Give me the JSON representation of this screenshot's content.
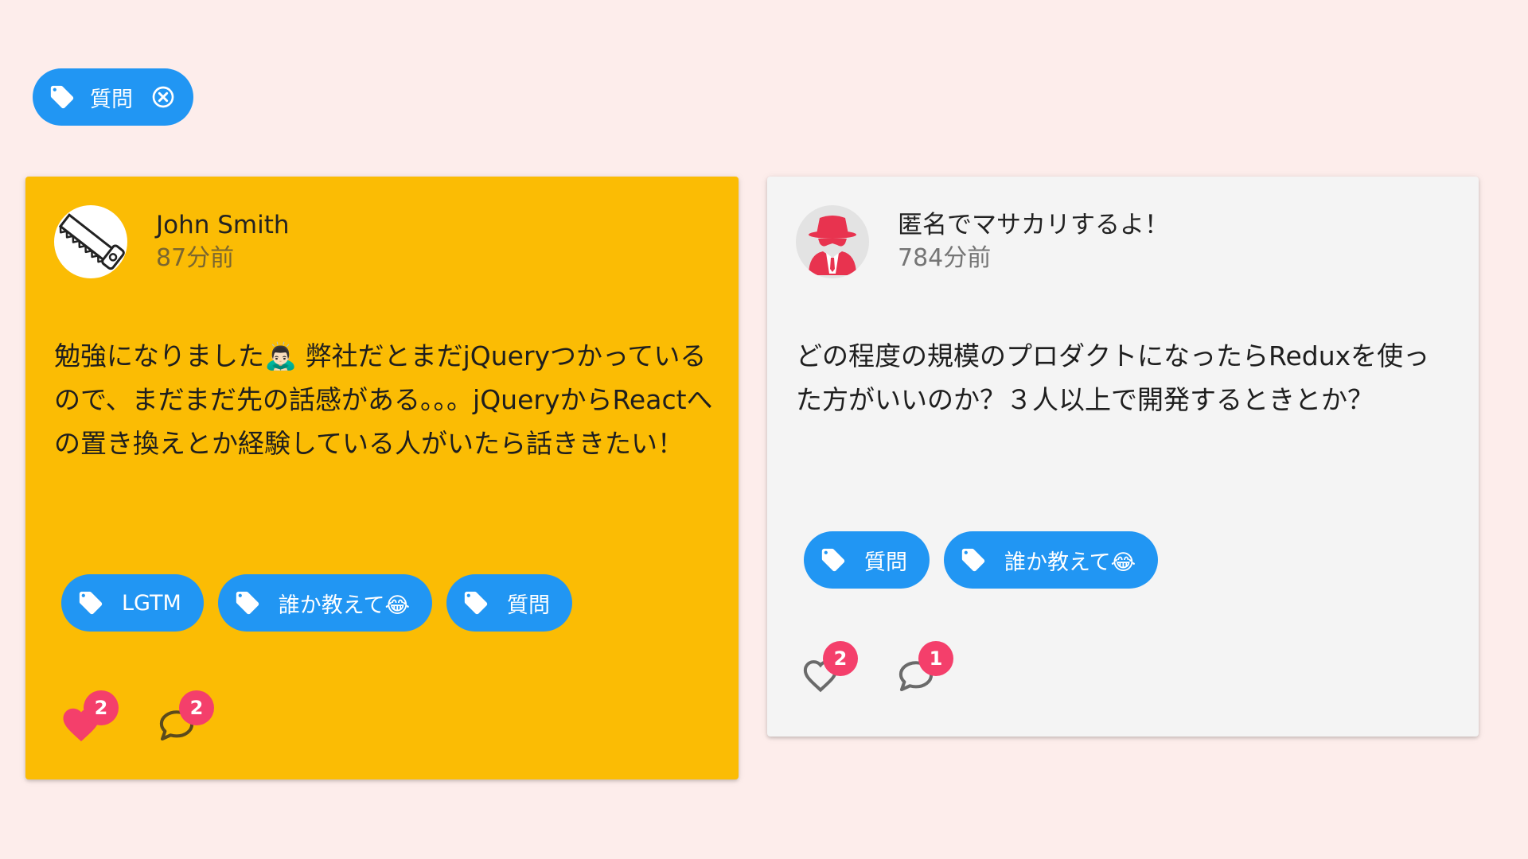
{
  "filter": {
    "label": "質問",
    "icon": "tag-icon",
    "clear_icon": "close-circle-icon"
  },
  "posts": [
    {
      "author": "John Smith",
      "time": "87分前",
      "avatar_icon": "saw-avatar-icon",
      "body": "勉強になりました🙇🏻‍♂️ 弊社だとまだjQueryつかっているので、まだまだ先の話感がある。。。jQueryからReactへの置き換えとか経験している人がいたら話ききたい！",
      "tags": [
        "LGTM",
        "誰か教えて😂",
        "質問"
      ],
      "likes": "2",
      "liked": true,
      "comments": "2",
      "background": "#fbbc04"
    },
    {
      "author": "匿名でマサカリするよ！",
      "time": "784分前",
      "avatar_icon": "anonymous-spy-avatar-icon",
      "body": "どの程度の規模のプロダクトになったらReduxを使った方がいいのか？３人以上で開発するときとか？",
      "tags": [
        "質問",
        "誰か教えて😂"
      ],
      "likes": "2",
      "liked": false,
      "comments": "1",
      "background": "#f4f4f4"
    }
  ],
  "colors": {
    "page_background": "#fdedeb",
    "chip": "#2196f3",
    "badge": "#f43f6b",
    "liked_heart": "#f43f6b"
  }
}
